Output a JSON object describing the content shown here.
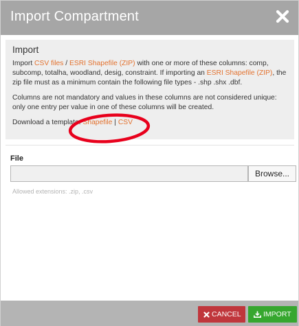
{
  "dialog": {
    "title": "Import Compartment",
    "close_icon": "close-icon"
  },
  "info": {
    "heading": "Import",
    "p1": {
      "t1": "Import ",
      "link_csv": "CSV files",
      "t2": " / ",
      "link_esri": "ESRI Shapefile (ZIP)",
      "t3": " with one or more of these columns: comp, subcomp, totalha, woodland, desig, constraint. If importing an ",
      "link_esri2": "ESRI Shapefile (ZIP)",
      "t4": ", the zip file must as a minimum contain the following file types - .shp .shx .dbf."
    },
    "p2": "Columns are not mandatory and values in these columns are not considered unique: only one entry per value in one of these columns will be created.",
    "template": {
      "prefix": "Download a template: ",
      "shapefile": "Shapefile",
      "sep": " | ",
      "csv": "CSV"
    }
  },
  "file": {
    "label": "File",
    "value": "",
    "browse_label": "Browse...",
    "allowed_extensions": "Allowed extensions: .zip, .csv"
  },
  "footer": {
    "cancel_label": "CANCEL",
    "import_label": "IMPORT"
  },
  "colors": {
    "titlebar": "#a6a6a6",
    "link": "#e3722f",
    "cancel": "#c0363c",
    "import": "#36a72f",
    "annotation": "#e8001c"
  }
}
